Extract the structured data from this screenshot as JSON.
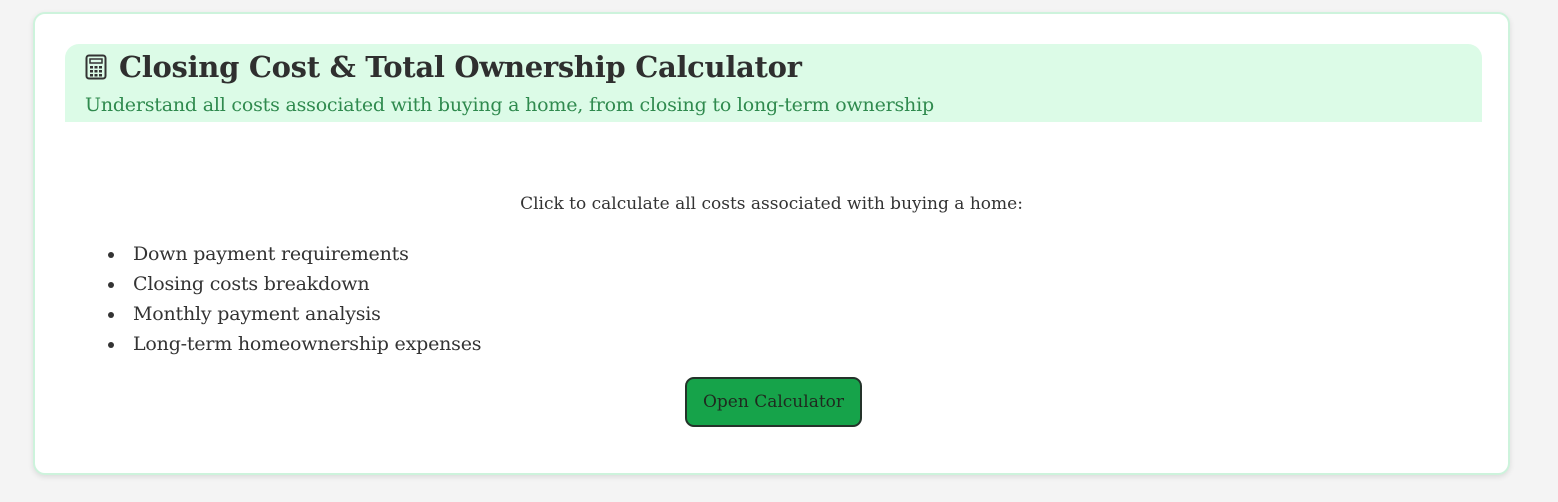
{
  "header": {
    "icon": "calculator-icon",
    "title": "Closing Cost & Total Ownership Calculator",
    "subtitle": "Understand all costs associated with buying a home, from closing to long-term ownership"
  },
  "main": {
    "intro": "Click to calculate all costs associated with buying a home:",
    "features": [
      "Down payment requirements",
      "Closing costs breakdown",
      "Monthly payment analysis",
      "Long-term homeownership expenses"
    ],
    "button_label": "Open Calculator"
  },
  "colors": {
    "accent": "#16a34a",
    "header_bg": "#dcfbe7",
    "subtitle": "#2f8a4e",
    "card_border": "#cdf3dc"
  }
}
